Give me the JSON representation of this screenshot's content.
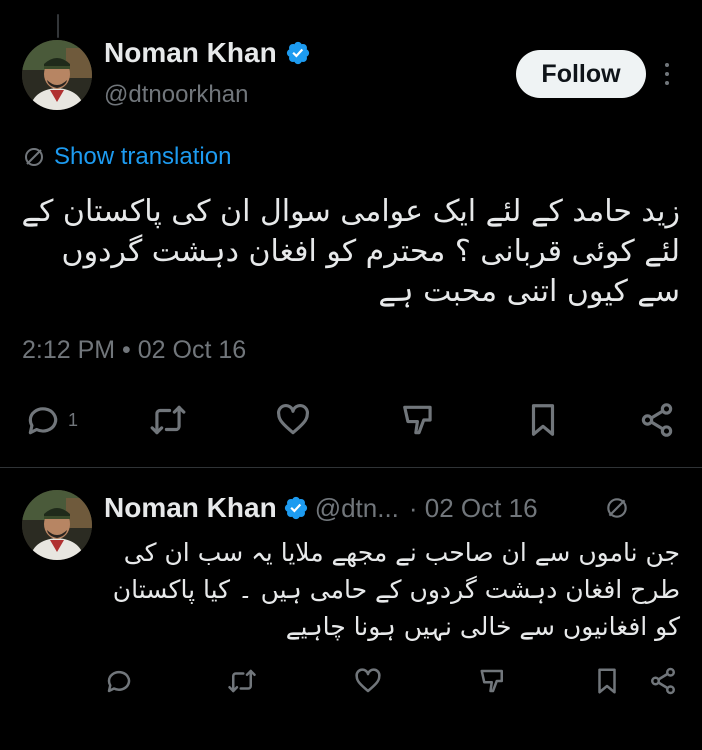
{
  "tweet": {
    "author_name": "Noman Khan",
    "author_handle": "@dtnoorkhan",
    "follow_label": "Follow",
    "translate_label": "Show translation",
    "text": "زید حامد کے لئے ایک عوامی سوال ان کی پاکستان کے لئے کوئی قربانی ؟ محترم کو افغان دہشت گردوں سے کیوں اتنی محبت ہے",
    "timestamp": "2:12 PM • 02 Oct 16",
    "reply_count": "1"
  },
  "reply": {
    "author_name": "Noman Khan",
    "author_handle": "@dtn...",
    "date": "· 02 Oct 16",
    "text": "جن ناموں سے ان صاحب نے مجھے ملایا یہ سب ان کی طرح افغان دہشت گردوں کے حامی ہیں ۔ کیا پاکستان کو افغانیوں سے خالی نہیں ہونا چاہیے"
  },
  "colors": {
    "background": "#000000",
    "text": "#e7e9ea",
    "muted": "#71767b",
    "link": "#1d9bf0",
    "verified": "#1d9bf0"
  },
  "icons": [
    "verified-badge-icon",
    "more-dots-icon",
    "translate-icon",
    "reply-icon",
    "retweet-icon",
    "like-icon",
    "dislike-icon",
    "bookmark-icon",
    "share-icon"
  ]
}
